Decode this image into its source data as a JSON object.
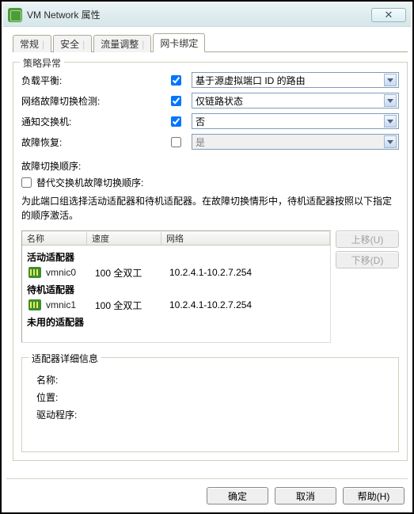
{
  "window": {
    "title": "VM Network 属性"
  },
  "tabs": [
    "常规",
    "安全",
    "流量调整",
    "网卡绑定"
  ],
  "active_tab_index": 3,
  "policy_group": {
    "legend": "策略异常",
    "rows": {
      "load_balancing": {
        "label": "负载平衡:",
        "value": "基于源虚拟端口 ID 的路由",
        "checked": true
      },
      "failover_detection": {
        "label": "网络故障切换检测:",
        "value": "仅链路状态",
        "checked": true
      },
      "notify_switches": {
        "label": "通知交换机:",
        "value": "否",
        "checked": true
      },
      "failback": {
        "label": "故障恢复:",
        "value": "是",
        "checked": false
      }
    },
    "failover_order_label": "故障切换顺序:",
    "override_checked": false,
    "override_label": "替代交换机故障切换顺序:",
    "note": "为此端口组选择活动适配器和待机适配器。在故障切换情形中，待机适配器按照以下指定的顺序激活。"
  },
  "list": {
    "columns": {
      "name": "名称",
      "speed": "速度",
      "network": "网络"
    },
    "groups": {
      "active": {
        "title": "活动适配器",
        "items": [
          {
            "name": "vmnic0",
            "speed": "100 全双工",
            "network": "10.2.4.1-10.2.7.254"
          }
        ]
      },
      "standby": {
        "title": "待机适配器",
        "items": [
          {
            "name": "vmnic1",
            "speed": "100 全双工",
            "network": "10.2.4.1-10.2.7.254"
          }
        ]
      },
      "unused": {
        "title": "未用的适配器",
        "items": []
      }
    }
  },
  "buttons": {
    "move_up": "上移(U)",
    "move_down": "下移(D)"
  },
  "details": {
    "legend": "适配器详细信息",
    "name_label": "名称:",
    "location_label": "位置:",
    "driver_label": "驱动程序:"
  },
  "footer": {
    "ok": "确定",
    "cancel": "取消",
    "help": "帮助(H)"
  },
  "close_glyph": "✕"
}
